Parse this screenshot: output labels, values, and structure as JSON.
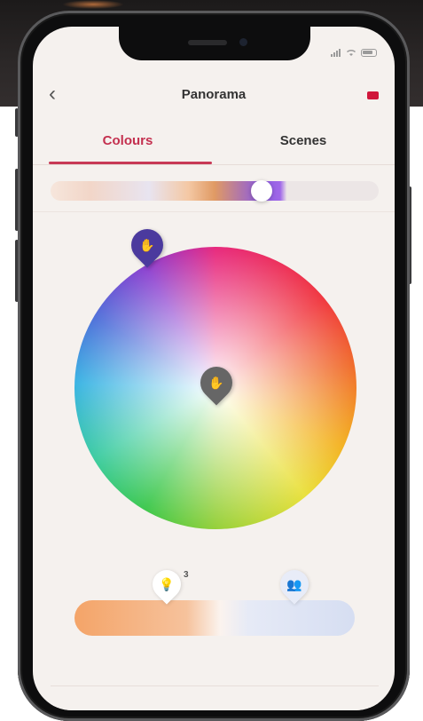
{
  "app": {
    "title": "Panorama",
    "back_icon": "chevron-left-icon",
    "flag_icon": "red-flag-icon",
    "accent_color": "#c83956"
  },
  "status_bar": {
    "icons": [
      "signal-icon",
      "wifi-icon",
      "battery-icon"
    ]
  },
  "tabs": [
    {
      "label": "Colours",
      "selected": true
    },
    {
      "label": "Scenes",
      "selected": false
    }
  ],
  "colour_slider": {
    "value": 0.66
  },
  "colour_wheel": {
    "pins": [
      {
        "name": "selected-light-pin",
        "icon": "hand-icon",
        "color": "#4b3a9e"
      },
      {
        "name": "center-light-pin",
        "icon": "hand-icon",
        "color": "#666666"
      }
    ]
  },
  "temperature_slider": {
    "warm_icon": "bulb-icon",
    "warm_badge": "3",
    "cool_icon": "group-icon"
  }
}
